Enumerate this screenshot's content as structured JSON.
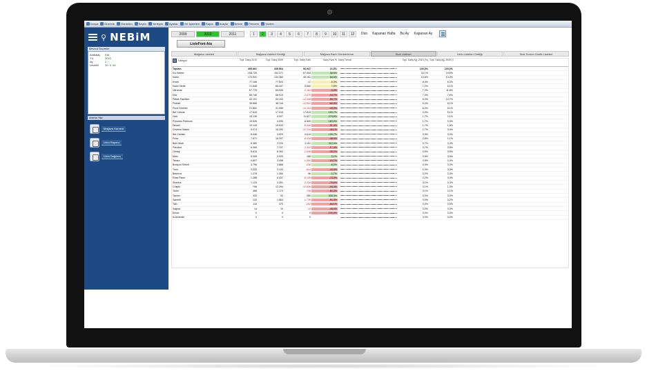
{
  "toolbar": {
    "items": [
      "Dosya",
      "Düzenle",
      "Görünüm",
      "Seçim",
      "Yerleşim",
      "Ayarlar",
      "Yer İşaretleri",
      "Rapor",
      "Araçlar",
      "Nesne",
      "Pencere",
      "Yardım"
    ]
  },
  "brand": {
    "logo": "NEBiM"
  },
  "sidebar": {
    "selections_header": "Mevcut Seçimler",
    "selections": [
      {
        "key": "Ambalaj",
        "value": "Ekil"
      },
      {
        "key": "Yıl",
        "value": "2010"
      },
      {
        "key": "Ay",
        "value": "2"
      },
      {
        "key": "Levell3",
        "value": "30, 3, 54"
      }
    ],
    "search_header": "Arama Yap",
    "nav": [
      {
        "label": "Mağaza Karnesi"
      },
      {
        "label": "Ürün Raporu"
      },
      {
        "label": "Ürün Dağılımı"
      }
    ]
  },
  "filters": {
    "years": [
      {
        "label": "2009",
        "active": false
      },
      {
        "label": "2010",
        "active": true
      },
      {
        "label": "2011",
        "active": false
      }
    ],
    "months": [
      {
        "label": "1",
        "active": false
      },
      {
        "label": "2",
        "active": true
      },
      {
        "label": "3",
        "active": false
      },
      {
        "label": "4",
        "active": false
      },
      {
        "label": "5",
        "active": false
      },
      {
        "label": "6",
        "active": false
      },
      {
        "label": "7",
        "active": false
      },
      {
        "label": "8",
        "active": false
      },
      {
        "label": "9",
        "active": false
      },
      {
        "label": "10",
        "active": false
      },
      {
        "label": "11",
        "active": false
      },
      {
        "label": "12",
        "active": false
      }
    ],
    "periods": [
      "Dün",
      "Kapanan Hafta",
      "Bu Ay",
      "Kapanan Ay"
    ]
  },
  "list_button": "ListeFont Ata",
  "tabs": [
    {
      "label": "Mağaza Listeleri",
      "active": false
    },
    {
      "label": "Mağaza Listeleri Grafiği",
      "active": false
    },
    {
      "label": "Mağaza Bazlı Görüntüleme",
      "active": false
    },
    {
      "label": "Stok Listeleri",
      "active": true
    },
    {
      "label": "Ürün Listeleri Grafiği",
      "active": false
    },
    {
      "label": "Stok Durum Grafik Listeleri",
      "active": false
    }
  ],
  "table": {
    "dimension_label": "Kategori",
    "headers": [
      "",
      "Topl. Satış 2010",
      "Topl. Satış 2009",
      "Topl. Satış Fark",
      "Satış Fark %",
      "Satış Trendi",
      "Topl. Satış Ağ. 2010 (%)",
      "Topl. Satış Ağ. 2009 (%)"
    ],
    "total": [
      "Toplam",
      "395.861",
      "335.564",
      "56.947",
      "16,5%",
      "",
      "100,0%",
      "100,0%"
    ],
    "rows": [
      [
        "Kız Bebek",
        "208.725",
        "154.371",
        "87.064",
        "38,6%",
        "",
        "33,1%",
        "19,5%",
        "green"
      ],
      [
        "Kadın",
        "179.541",
        "134.360",
        "45.161",
        "68,6%",
        "",
        "13,6%",
        "13,0%",
        "green"
      ],
      [
        "Erkek",
        "77.156",
        "77.803",
        "-42",
        "-0,3%",
        "",
        "8,3%",
        "6,3%",
        "yellow"
      ],
      [
        "Kadın Bebe",
        "71.648",
        "66.447",
        "5.660",
        "7,5%",
        "",
        "7,2%",
        "6,1%",
        "yellow"
      ],
      [
        "Ultramar",
        "67.775",
        "69.928",
        "-2.164",
        "-3,4%",
        "",
        "7,2%",
        "11,8%",
        "red"
      ],
      [
        "Dior",
        "66.746",
        "68.915",
        "-2.670",
        "-18,7%",
        "",
        "7,0%",
        "7,6%",
        "red"
      ],
      [
        "Palais Papillion",
        "42.101",
        "54.100",
        "-12.046",
        "-58,7%",
        "",
        "6,0%",
        "10,7%",
        "red"
      ],
      [
        "Pediatr",
        "35.686",
        "38.116",
        "-12.831",
        "-60,9%",
        "",
        "6,0%",
        "8,1%",
        "red"
      ],
      [
        "Pune Desiree",
        "21.852",
        "31.956",
        "-10.104",
        "-39,9%",
        "",
        "6,0%",
        "8,1%",
        "red"
      ],
      [
        "Bel Carlots",
        "17.815",
        "17.016",
        "17.815",
        "100,7%",
        "",
        "3,0%",
        "5,1%",
        "green"
      ],
      [
        "Helo",
        "15.136",
        "4.007",
        "11.627",
        "279,8%",
        "",
        "1,7%",
        "3,1%",
        "green"
      ],
      [
        "Princess Platinum",
        "10.526",
        "4.090",
        "6.509",
        "183,0%",
        "",
        "1,7%",
        "0,4%",
        "green"
      ],
      [
        "Dinseli",
        "10.145",
        "15.533",
        "-5.346",
        "-31,4%",
        "",
        "1,7%",
        "1,8%",
        "red"
      ],
      [
        "Ceviene Maare",
        "9.074",
        "16.393",
        "-10.319",
        "-48,1%",
        "",
        "1,7%",
        "0,4%",
        "red"
      ],
      [
        "Bel Carlisle",
        "8.548",
        "3.929",
        "4.619",
        "199,7%",
        "",
        "0,9%",
        "0,4%",
        "green"
      ],
      [
        "Prisa",
        "7.871",
        "16.297",
        "-8.426",
        "-48,9%",
        "",
        "0,8%",
        "1,1%",
        "red"
      ],
      [
        "Bele Modi",
        "6.380",
        "2.229",
        "4.151",
        "210,4%",
        "",
        "0,7%",
        "0,4%",
        "green"
      ],
      [
        "Pandiun",
        "6.365",
        "7.707",
        "-1.342",
        "-17,4%",
        "",
        "0,7%",
        "0,5%",
        "red"
      ],
      [
        "Ohnay",
        "5.815",
        "8.363",
        "-2.548",
        "-38,2%",
        "",
        "0,6%",
        "0,5%",
        "red"
      ],
      [
        "Mirsi",
        "5.308",
        "3.925",
        "188",
        "5,1%",
        "",
        "0,5%",
        "0,5%",
        "green"
      ],
      [
        "Tessur",
        "4.807",
        "3.456",
        "-1.350",
        "-16,7%",
        "",
        "0,5%",
        "0,4%",
        "red"
      ],
      [
        "Bodyzul Sirbelt",
        "3.796",
        "3.888",
        "-238",
        "-6,0%",
        "",
        "0,4%",
        "0,3%",
        "green"
      ],
      [
        "Tiore",
        "3.333",
        "2.133",
        "-814",
        "-44,0%",
        "",
        "0,3%",
        "0,3%",
        "red"
      ],
      [
        "Belerica",
        "1.378",
        "1.350",
        "96",
        "0,7%",
        "",
        "0,2%",
        "0,3%",
        "green"
      ],
      [
        "Ross Place",
        "1.288",
        "6.437",
        "-5.149",
        "-73,3%",
        "",
        "0,2%",
        "0,4%",
        "red"
      ],
      [
        "Sharina",
        "1.125",
        "3.351",
        "-2.226",
        "-75,6%",
        "",
        "0,1%",
        "0,3%",
        "red"
      ],
      [
        "Cosplli",
        "758",
        "13.394",
        "-12.636",
        "-94,4%",
        "",
        "0,1%",
        "1,3%",
        "red"
      ],
      [
        "Tores",
        "466",
        "1.174",
        "-708",
        "-60,3%",
        "",
        "0,1%",
        "0,1%",
        "red"
      ],
      [
        "Tanner",
        "333",
        "53",
        "280",
        "528,3%",
        "",
        "0,0%",
        "0,0%",
        "green"
      ],
      [
        "Samirill",
        "125",
        "1.864",
        "-1.739",
        "-93,3%",
        "",
        "0,0%",
        "0,2%",
        "red"
      ],
      [
        "Tain",
        "118",
        "370",
        "-252",
        "-68,1%",
        "",
        "0,0%",
        "0,0%",
        "red"
      ],
      [
        "Sagisa",
        "14",
        "10",
        "-11",
        "-45,0%",
        "",
        "0,0%",
        "0,0%",
        "red"
      ],
      [
        "Emde",
        "0",
        "0",
        "0",
        "-100,0%",
        "",
        "0,0%",
        "0,0%",
        "red"
      ],
      [
        "Is Ariarrale",
        "0",
        "0",
        "0",
        "",
        "",
        "0,0%",
        "0,0%",
        ""
      ]
    ]
  },
  "colors": {
    "sidebar": "#1d4a82",
    "active_green": "#28c828",
    "negative": "#f4a0a0",
    "positive": "#bfe8b0",
    "neutral": "#fbf0a8"
  }
}
